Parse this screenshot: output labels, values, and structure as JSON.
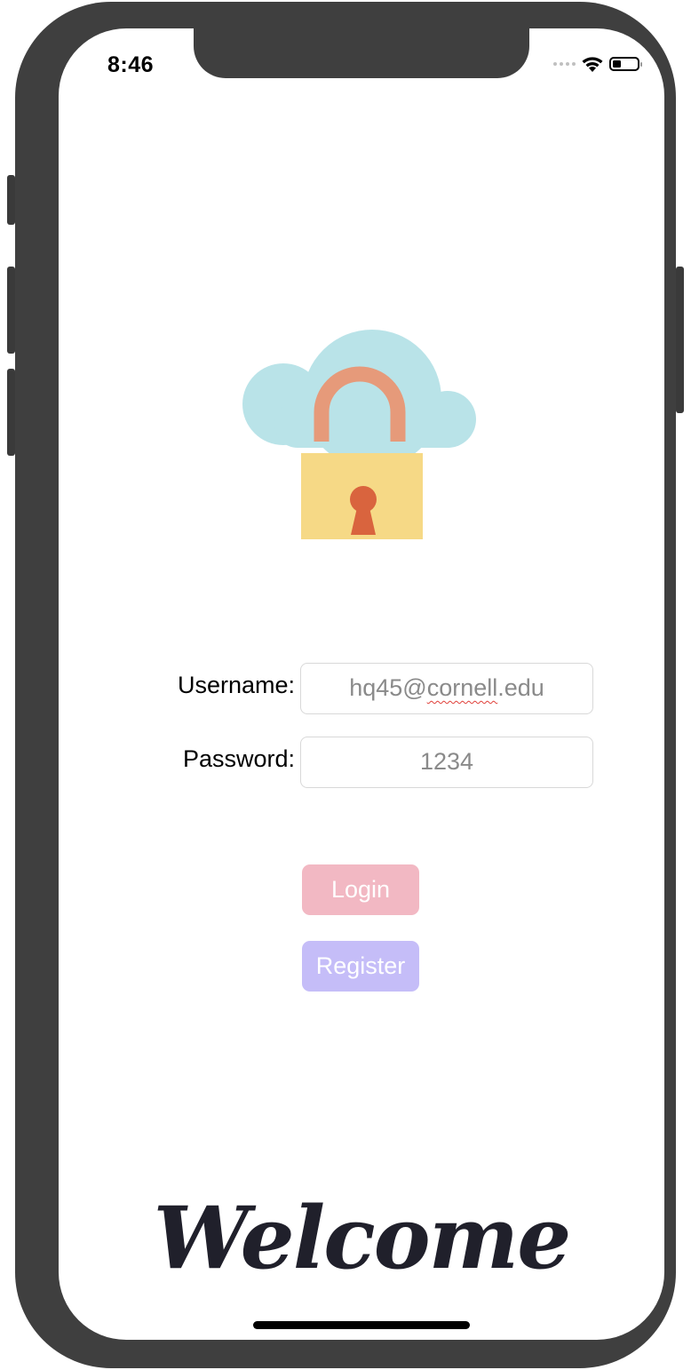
{
  "status_bar": {
    "time": "8:46",
    "battery_level": 0.35
  },
  "login_form": {
    "username_label": "Username:",
    "username_value_prefix": "hq45@",
    "username_value_flagged": "cornell",
    "username_value_suffix": ".edu",
    "password_label": "Password:",
    "password_value": "1234"
  },
  "buttons": {
    "login_label": "Login",
    "register_label": "Register"
  },
  "footer": {
    "welcome_text": "Welcome"
  },
  "icons": {
    "illustration": "cloud-padlock-icon",
    "wifi": "wifi-icon",
    "battery": "battery-icon",
    "signal": "cellular-signal-icon"
  },
  "colors": {
    "login_button": "#f2b8c3",
    "register_button": "#c5bdf8",
    "cloud": "#b9e3e8",
    "lock_body": "#f6d986",
    "lock_shackle": "#e69a7a",
    "keyhole": "#d9643e",
    "welcome_text": "#20202b"
  }
}
